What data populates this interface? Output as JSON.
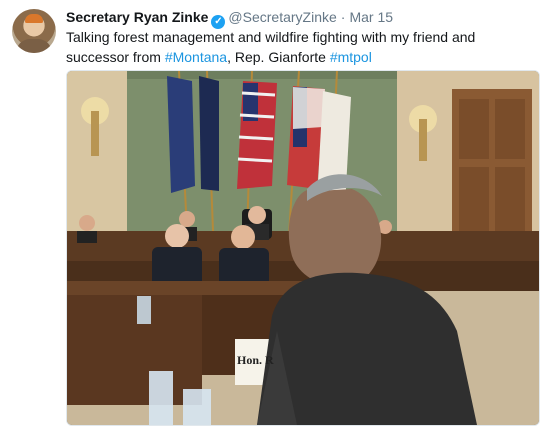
{
  "tweet": {
    "author_name": "Secretary Ryan Zinke",
    "handle": "@SecretaryZinke",
    "separator": "·",
    "date": "Mar 15",
    "verified_icon": "verified-badge-icon",
    "text_part1": "Talking forest management and wildfire fighting with my friend and successor from ",
    "hashtag_1": "#Montana",
    "text_part2": ", Rep. Gianforte ",
    "hashtag_2": "#mtpol"
  },
  "photo": {
    "nameplate_text": "Hon. R"
  },
  "colors": {
    "link": "#1b95e0",
    "verified": "#1da1f2"
  }
}
